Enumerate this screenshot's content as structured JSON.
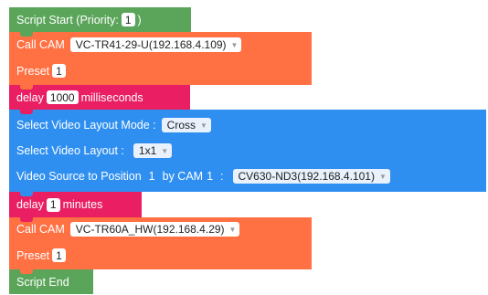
{
  "script_start": {
    "label": "Script Start (Priority:",
    "priority": "1",
    "close": ")"
  },
  "call_cam_1": {
    "label": "Call CAM",
    "camera": "VC-TR41-29-U(192.168.4.109)",
    "preset_label": "Preset",
    "preset": "1"
  },
  "delay_1": {
    "label": "delay",
    "value": "1000",
    "unit": "milliseconds"
  },
  "layout": {
    "mode_label": "Select Video Layout Mode :",
    "mode_value": "Cross",
    "layout_label": "Select Video Layout :",
    "layout_value": "1x1",
    "source_label": "Video Source to Position",
    "position": "1",
    "by_cam_label": "by CAM",
    "cam_number": "1",
    "colon": ":",
    "source_value": "CV630-ND3(192.168.4.101)"
  },
  "delay_2": {
    "label": "delay",
    "value": "1",
    "unit": "minutes"
  },
  "call_cam_2": {
    "label": "Call CAM",
    "camera": "VC-TR60A_HW(192.168.4.29)",
    "preset_label": "Preset",
    "preset": "1"
  },
  "script_end": {
    "label": "Script End"
  },
  "icons": {
    "dropdown": "chevron-down-icon"
  },
  "colors": {
    "green": "#5ba55b",
    "orange": "#ff7043",
    "red": "#e91e63",
    "blue": "#2f8ff0"
  }
}
